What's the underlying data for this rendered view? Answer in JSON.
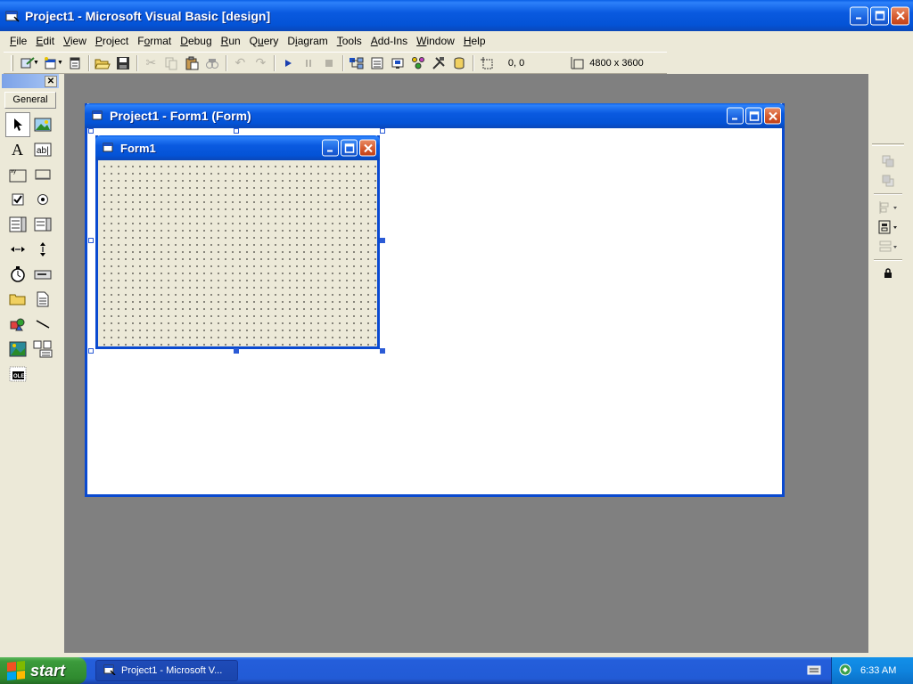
{
  "window": {
    "title": "Project1 - Microsoft Visual Basic [design]"
  },
  "menu": [
    {
      "pre": "",
      "ul": "F",
      "post": "ile"
    },
    {
      "pre": "",
      "ul": "E",
      "post": "dit"
    },
    {
      "pre": "",
      "ul": "V",
      "post": "iew"
    },
    {
      "pre": "",
      "ul": "P",
      "post": "roject"
    },
    {
      "pre": "F",
      "ul": "o",
      "post": "rmat"
    },
    {
      "pre": "",
      "ul": "D",
      "post": "ebug"
    },
    {
      "pre": "",
      "ul": "R",
      "post": "un"
    },
    {
      "pre": "Q",
      "ul": "u",
      "post": "ery"
    },
    {
      "pre": "D",
      "ul": "i",
      "post": "agram"
    },
    {
      "pre": "",
      "ul": "T",
      "post": "ools"
    },
    {
      "pre": "",
      "ul": "A",
      "post": "dd-Ins"
    },
    {
      "pre": "",
      "ul": "W",
      "post": "indow"
    },
    {
      "pre": "",
      "ul": "H",
      "post": "elp"
    }
  ],
  "toolbar": {
    "position": "0, 0",
    "size": "4800 x 3600"
  },
  "toolbox": {
    "tab_label": "General",
    "close_glyph": "✕"
  },
  "designer": {
    "title": "Project1 - Form1 (Form)"
  },
  "form1": {
    "title": "Form1"
  },
  "taskbar": {
    "start_label": "start",
    "task_label": "Project1 - Microsoft V...",
    "clock": "6:33 AM"
  },
  "colors": {
    "title_blue": "#0a5ae0",
    "mdi_gray": "#808080",
    "taskbar_blue": "#245edb",
    "start_green": "#3c9b3c"
  }
}
